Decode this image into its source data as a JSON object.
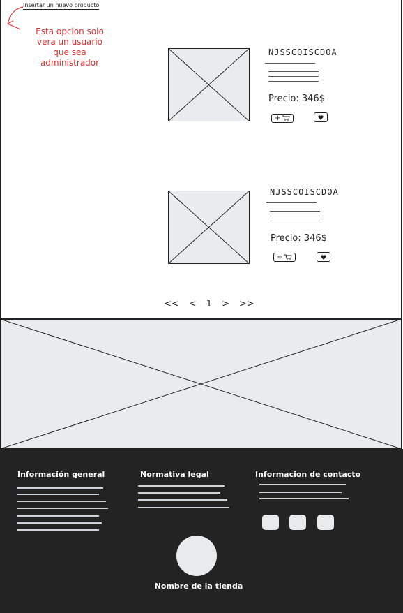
{
  "admin": {
    "insert_link": "Insertar un nuevo producto",
    "note": "Esta opcion solo vera un usuario que sea administrador"
  },
  "products": [
    {
      "name": "NJSSCOISCDOA",
      "price": "Precio: 346$",
      "cart_icon": "cart-icon",
      "cart_plus": "+",
      "fav_icon": "heart-icon"
    },
    {
      "name": "NJSSCOISCDOA",
      "price": "Precio: 346$",
      "cart_icon": "cart-icon",
      "cart_plus": "+",
      "fav_icon": "heart-icon"
    }
  ],
  "pagination": {
    "first": "<<",
    "prev": "<",
    "current": "1",
    "next": ">",
    "last": ">>"
  },
  "footer": {
    "general": "Información general",
    "legal": "Normativa legal",
    "contact": "Informacion de contacto",
    "store_name": "Nombre de la tienda"
  },
  "colors": {
    "placeholder": "#e9ecef",
    "footer_bg": "#232323",
    "note": "#e03131"
  }
}
